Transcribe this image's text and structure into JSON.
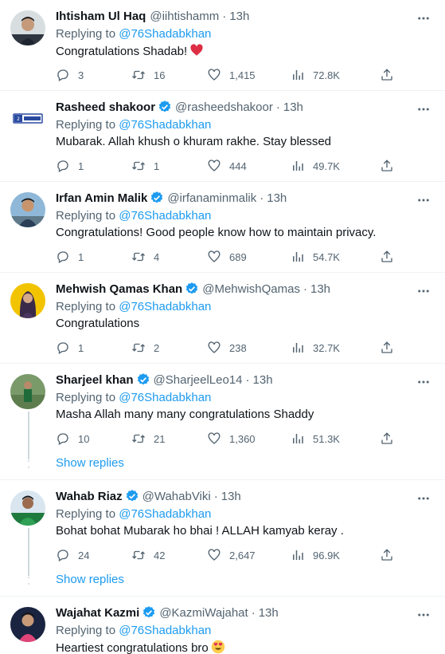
{
  "replying_to_label": "Replying to",
  "show_replies_label": "Show replies",
  "colors": {
    "accent": "#1d9bf0",
    "muted": "#536471",
    "heart": "#f91880",
    "verified": "#1d9bf0"
  },
  "tweets": [
    {
      "name": "Ihtisham Ul Haq",
      "verified": false,
      "handle": "@iihtishamm",
      "time": "13h",
      "mention": "@76Shadabkhan",
      "text": "Congratulations Shadab!",
      "emoji": "red-heart",
      "replies": "3",
      "retweets": "16",
      "likes": "1,415",
      "views": "72.8K"
    },
    {
      "name": "Rasheed shakoor",
      "verified": true,
      "handle": "@rasheedshakoor",
      "time": "13h",
      "mention": "@76Shadabkhan",
      "text": "Mubarak. Allah khush o khuram rakhe. Stay blessed",
      "emoji": "",
      "replies": "1",
      "retweets": "1",
      "likes": "444",
      "views": "49.7K"
    },
    {
      "name": "Irfan Amin Malik",
      "verified": true,
      "handle": "@irfanaminmalik",
      "time": "13h",
      "mention": "@76Shadabkhan",
      "text": "Congratulations! Good people know how to maintain privacy.",
      "emoji": "",
      "replies": "1",
      "retweets": "4",
      "likes": "689",
      "views": "54.7K"
    },
    {
      "name": "Mehwish Qamas Khan",
      "verified": true,
      "handle": "@MehwishQamas",
      "time": "13h",
      "mention": "@76Shadabkhan",
      "text": "Congratulations",
      "emoji": "",
      "replies": "1",
      "retweets": "2",
      "likes": "238",
      "views": "32.7K"
    },
    {
      "name": "Sharjeel khan",
      "verified": true,
      "handle": "@SharjeelLeo14",
      "time": "13h",
      "mention": "@76Shadabkhan",
      "text": "Masha Allah many many congratulations Shaddy",
      "emoji": "",
      "replies": "10",
      "retweets": "21",
      "likes": "1,360",
      "views": "51.3K"
    },
    {
      "name": "Wahab Riaz",
      "verified": true,
      "handle": "@WahabViki",
      "time": "13h",
      "mention": "@76Shadabkhan",
      "text": "Bohat bohat Mubarak ho bhai ! ALLAH kamyab keray .",
      "emoji": "",
      "replies": "24",
      "retweets": "42",
      "likes": "2,647",
      "views": "96.9K"
    },
    {
      "name": "Wajahat Kazmi",
      "verified": true,
      "handle": "@KazmiWajahat",
      "time": "13h",
      "mention": "@76Shadabkhan",
      "text": "Heartiest congratulations bro",
      "emoji": "heart-eyes",
      "replies": "",
      "retweets": "",
      "likes": "",
      "views": ""
    }
  ]
}
